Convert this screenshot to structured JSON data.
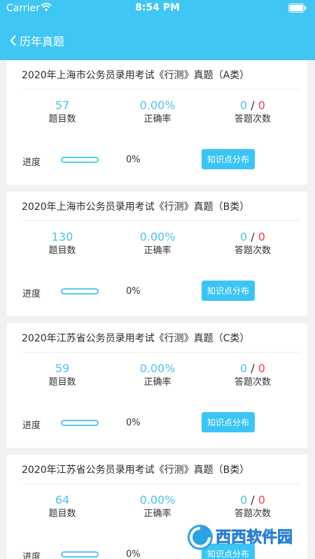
{
  "status_bar": {
    "carrier": "Carrier",
    "time": "8:54 PM"
  },
  "nav": {
    "title": "历年真题"
  },
  "labels": {
    "questions": "题目数",
    "accuracy": "正确率",
    "attempts": "答题次数",
    "progress": "进度",
    "knowledge_button": "知识点分布"
  },
  "colors": {
    "header": "#3fc6f2",
    "accent": "#4cc3ec",
    "attempts_right": "#f0434d"
  },
  "cards": [
    {
      "title": "2020年上海市公务员录用考试《行测》真题（A类）",
      "questions": "57",
      "accuracy": "0.00%",
      "attempts_done": "0",
      "attempts_sep": "/",
      "attempts_total": "0",
      "progress": "0%",
      "progress_value": 0
    },
    {
      "title": "2020年上海市公务员录用考试《行测》真题（B类）",
      "questions": "130",
      "accuracy": "0.00%",
      "attempts_done": "0",
      "attempts_sep": "/",
      "attempts_total": "0",
      "progress": "0%",
      "progress_value": 0
    },
    {
      "title": "2020年江苏省公务员录用考试《行测》真题（C类）",
      "questions": "59",
      "accuracy": "0.00%",
      "attempts_done": "0",
      "attempts_sep": "/",
      "attempts_total": "0",
      "progress": "0%",
      "progress_value": 0
    },
    {
      "title": "2020年江苏省公务员录用考试《行测》真题（B类）",
      "questions": "64",
      "accuracy": "0.00%",
      "attempts_done": "0",
      "attempts_sep": "/",
      "attempts_total": "0",
      "progress": "0%",
      "progress_value": 0
    }
  ],
  "watermark": {
    "text": "西西软件园",
    "sub": "CR173.COM"
  }
}
